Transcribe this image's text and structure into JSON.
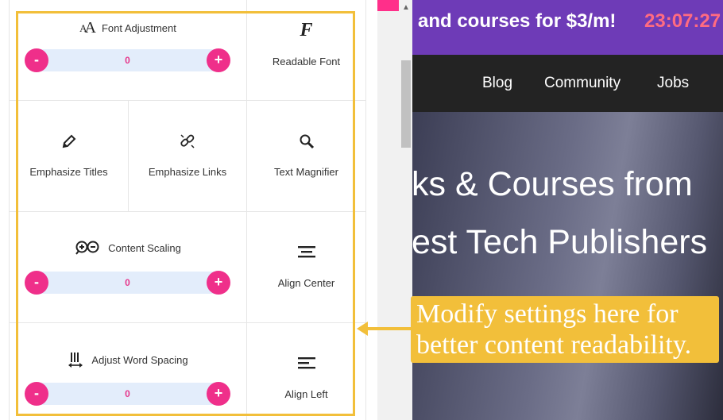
{
  "panel": {
    "font_adjustment": {
      "label": "Font Adjustment",
      "value": "0",
      "minus": "-",
      "plus": "+"
    },
    "readable_font": {
      "label": "Readable Font",
      "icon": "readable-font-icon",
      "glyph": "F"
    },
    "emphasize_titles": {
      "label": "Emphasize Titles",
      "icon": "pencil-icon"
    },
    "emphasize_links": {
      "label": "Emphasize Links",
      "icon": "broken-link-icon"
    },
    "text_magnifier": {
      "label": "Text Magnifier",
      "icon": "magnifier-icon"
    },
    "content_scaling": {
      "label": "Content Scaling",
      "value": "0",
      "minus": "-",
      "plus": "+"
    },
    "align_center": {
      "label": "Align Center",
      "icon": "align-center-icon"
    },
    "adjust_word_spacing": {
      "label": "Adjust Word Spacing",
      "value": "0",
      "minus": "-",
      "plus": "+"
    },
    "align_left": {
      "label": "Align Left",
      "icon": "align-left-icon"
    }
  },
  "site": {
    "promo_text": "and courses for $3/m!",
    "promo_timer": "23:07:27",
    "nav": [
      "Blog",
      "Community",
      "Jobs"
    ],
    "hero_line_1": "ks & Courses from",
    "hero_line_2": "est Tech Publishers"
  },
  "callout": {
    "line_1": "Modify settings here for",
    "line_2": "better content readability."
  },
  "colors": {
    "accent_pink": "#ef2f8a",
    "stepper_bg": "#e3edfb",
    "highlight_yellow": "#f2bf3a",
    "promo_purple": "#6e3bb7",
    "timer_red": "#ff6b81",
    "nav_dark": "#232323"
  }
}
